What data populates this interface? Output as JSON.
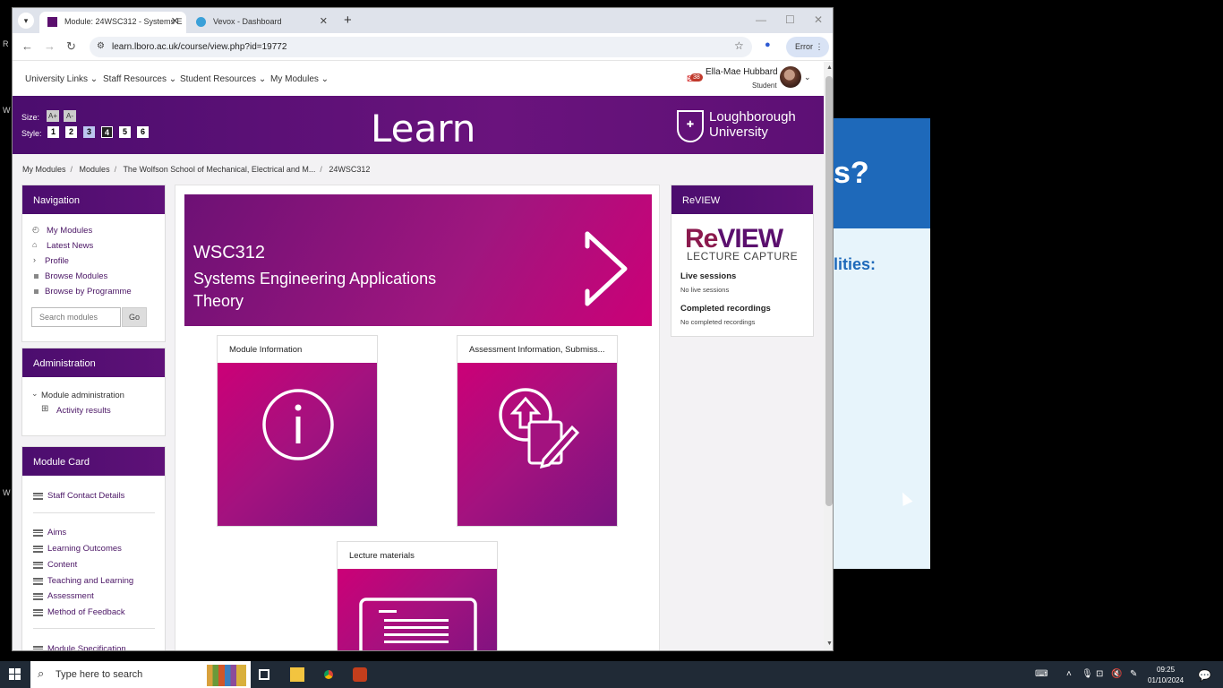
{
  "browser": {
    "tabs": [
      {
        "title": "Module: 24WSC312 - Systems E",
        "active": true
      },
      {
        "title": "Vevox - Dashboard",
        "active": false
      }
    ],
    "url": "learn.lboro.ac.uk/course/view.php?id=19772",
    "error_label": "Error"
  },
  "topnav": {
    "items": [
      "University Links",
      "Staff Resources",
      "Student Resources",
      "My Modules"
    ],
    "notification_count": "38",
    "user_name": "Ella-Mae Hubbard",
    "user_role": "Student"
  },
  "banner": {
    "size_label": "Size:",
    "size_buttons": [
      "A+",
      "A-"
    ],
    "style_label": "Style:",
    "style_buttons": [
      "1",
      "2",
      "3",
      "4",
      "5",
      "6"
    ],
    "title": "Learn",
    "university_line1": "Loughborough",
    "university_line2": "University"
  },
  "breadcrumb": [
    "My Modules",
    "Modules",
    "The Wolfson School of Mechanical, Electrical and M...",
    "24WSC312"
  ],
  "navigation": {
    "title": "Navigation",
    "items": [
      "My Modules",
      "Latest News",
      "Profile",
      "Browse Modules",
      "Browse by Programme"
    ],
    "search_placeholder": "Search modules",
    "go_label": "Go"
  },
  "administration": {
    "title": "Administration",
    "items": [
      "Module administration",
      "Activity results"
    ]
  },
  "module_card": {
    "title": "Module Card",
    "items": [
      "Staff Contact Details",
      "Aims",
      "Learning Outcomes",
      "Content",
      "Teaching and Learning",
      "Assessment",
      "Method of Feedback",
      "Module Specification"
    ]
  },
  "hero": {
    "code": "WSC312",
    "name": "Systems Engineering Applications Theory"
  },
  "tiles": [
    "Module Information",
    "Assessment Information, Submiss...",
    "Lecture materials"
  ],
  "review": {
    "title": "ReVIEW",
    "logo_re": "Re",
    "logo_view": "VIEW",
    "logo_sub": "LECTURE CAPTURE",
    "live_heading": "Live sessions",
    "live_text": "No live sessions",
    "recorded_heading": "Completed recordings",
    "recorded_text": "No completed recordings"
  },
  "background_window": {
    "heading_fragment": "s?",
    "subheading_fragment": "lities:"
  },
  "taskbar": {
    "search_placeholder": "Type here to search",
    "time": "09:25",
    "date": "01/10/2024"
  },
  "colors": {
    "brand_purple": "#4b0d6e",
    "brand_magenta": "#cc0077"
  }
}
